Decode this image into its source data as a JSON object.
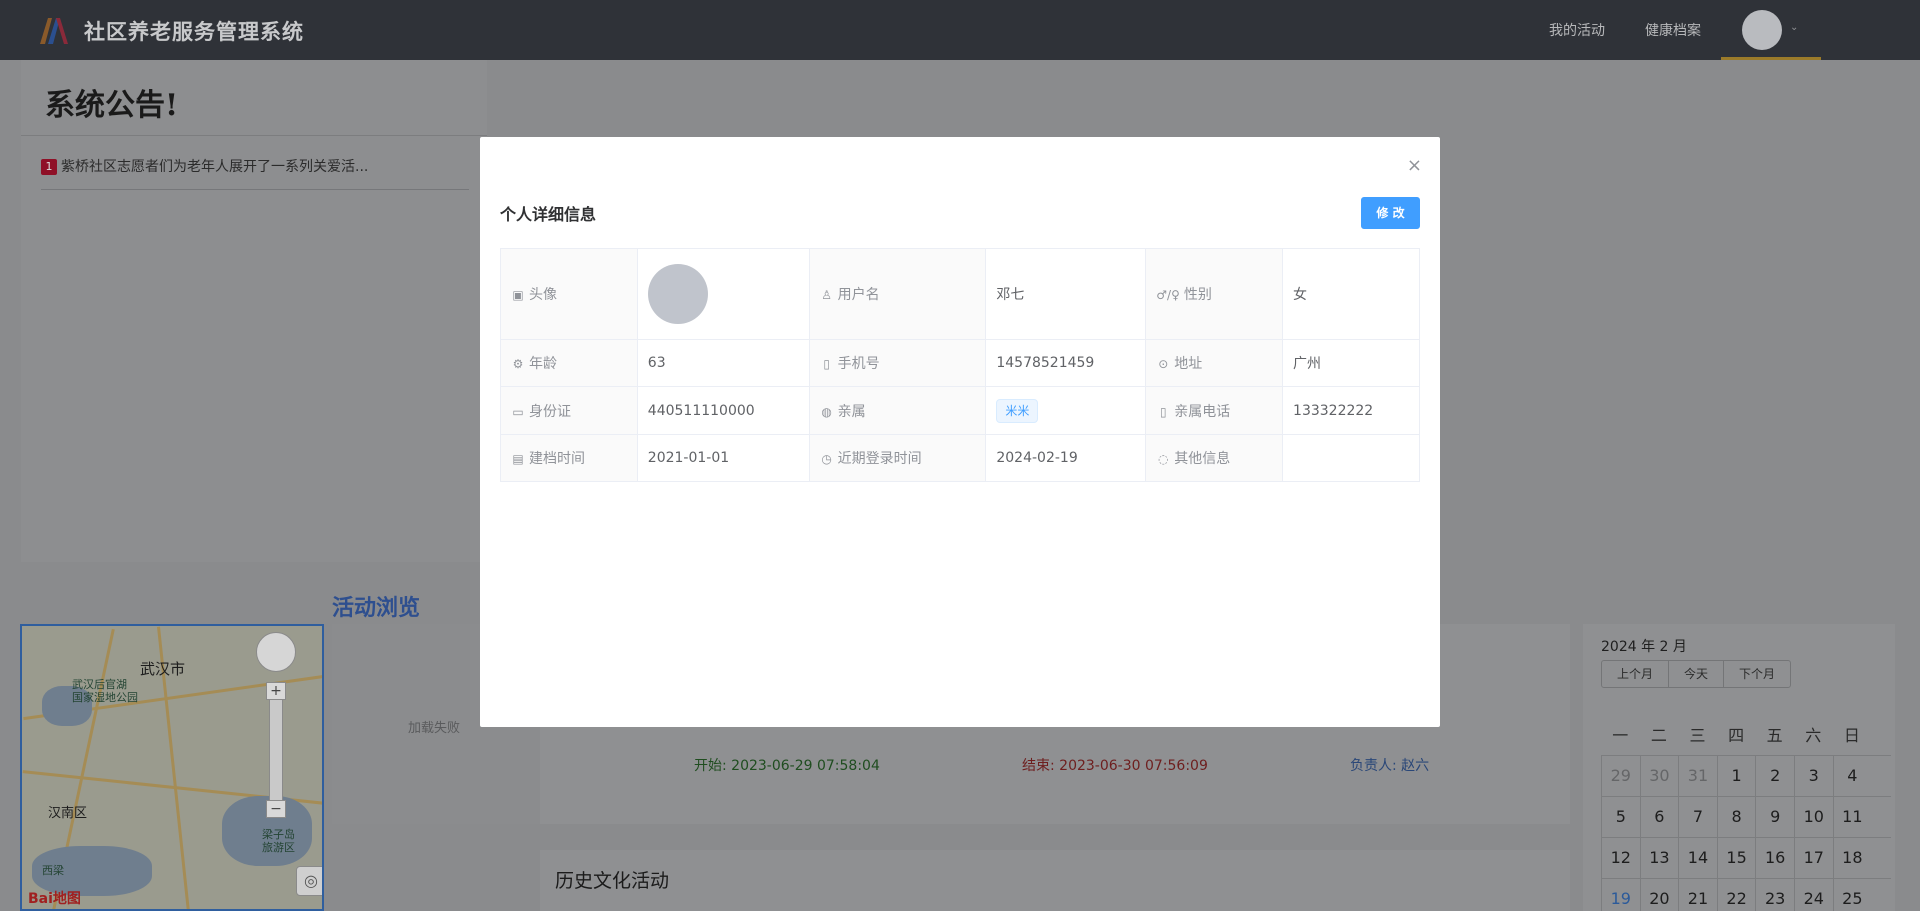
{
  "app": {
    "title": "社区养老服务管理系统",
    "nav": [
      "我的活动",
      "健康档案"
    ]
  },
  "notice": {
    "heading": "系统公告!",
    "items": [
      {
        "index": "1",
        "text": "紫桥社区志愿者们为老年人展开了一系列关爱活..."
      }
    ]
  },
  "activities": {
    "section_title": "活动浏览",
    "image_fallback": "加载失败",
    "start": "开始: 2023-06-29 07:58:04",
    "end": "结束: 2023-06-30 07:56:09",
    "owner": "负责人: 赵六",
    "history_title": "历史文化活动"
  },
  "map": {
    "city": "武汉市",
    "district": "汉南区",
    "poi_1": "武汉后官湖",
    "poi_1b": "国家湿地公园",
    "poi_2": "梁子岛",
    "poi_2b": "旅游区",
    "town": "西梁",
    "brand": "Bai地图"
  },
  "calendar": {
    "title": "2024 年 2 月",
    "buttons": [
      "上个月",
      "今天",
      "下个月"
    ],
    "weekdays": [
      "一",
      "二",
      "三",
      "四",
      "五",
      "六",
      "日"
    ],
    "rows": [
      [
        "29",
        "30",
        "31",
        "1",
        "2",
        "3",
        "4"
      ],
      [
        "5",
        "6",
        "7",
        "8",
        "9",
        "10",
        "11"
      ],
      [
        "12",
        "13",
        "14",
        "15",
        "16",
        "17",
        "18"
      ],
      [
        "19",
        "20",
        "21",
        "22",
        "23",
        "24",
        "25"
      ]
    ]
  },
  "dialog": {
    "title": "个人详细信息",
    "edit_label": "修 改",
    "close_glyph": "×",
    "labels": {
      "avatar": "头像",
      "username": "用户名",
      "gender": "性别",
      "age": "年龄",
      "phone": "手机号",
      "address": "地址",
      "id_card": "身份证",
      "relative": "亲属",
      "relative_phone": "亲属电话",
      "created": "建档时间",
      "last_login": "近期登录时间",
      "other": "其他信息"
    },
    "values": {
      "username": "邓七",
      "gender": "女",
      "age": "63",
      "phone": "14578521459",
      "address": "广州",
      "id_card": "440511110000",
      "relative": "米米",
      "relative_phone": "133322222",
      "created": "2021-01-01",
      "last_login": "2024-02-19",
      "other": ""
    },
    "gender_icon_glyph": "♂/♀"
  },
  "colors": {
    "primary": "#409eff",
    "header_bg": "#2f3238",
    "tag_bg": "#ecf5ff"
  }
}
